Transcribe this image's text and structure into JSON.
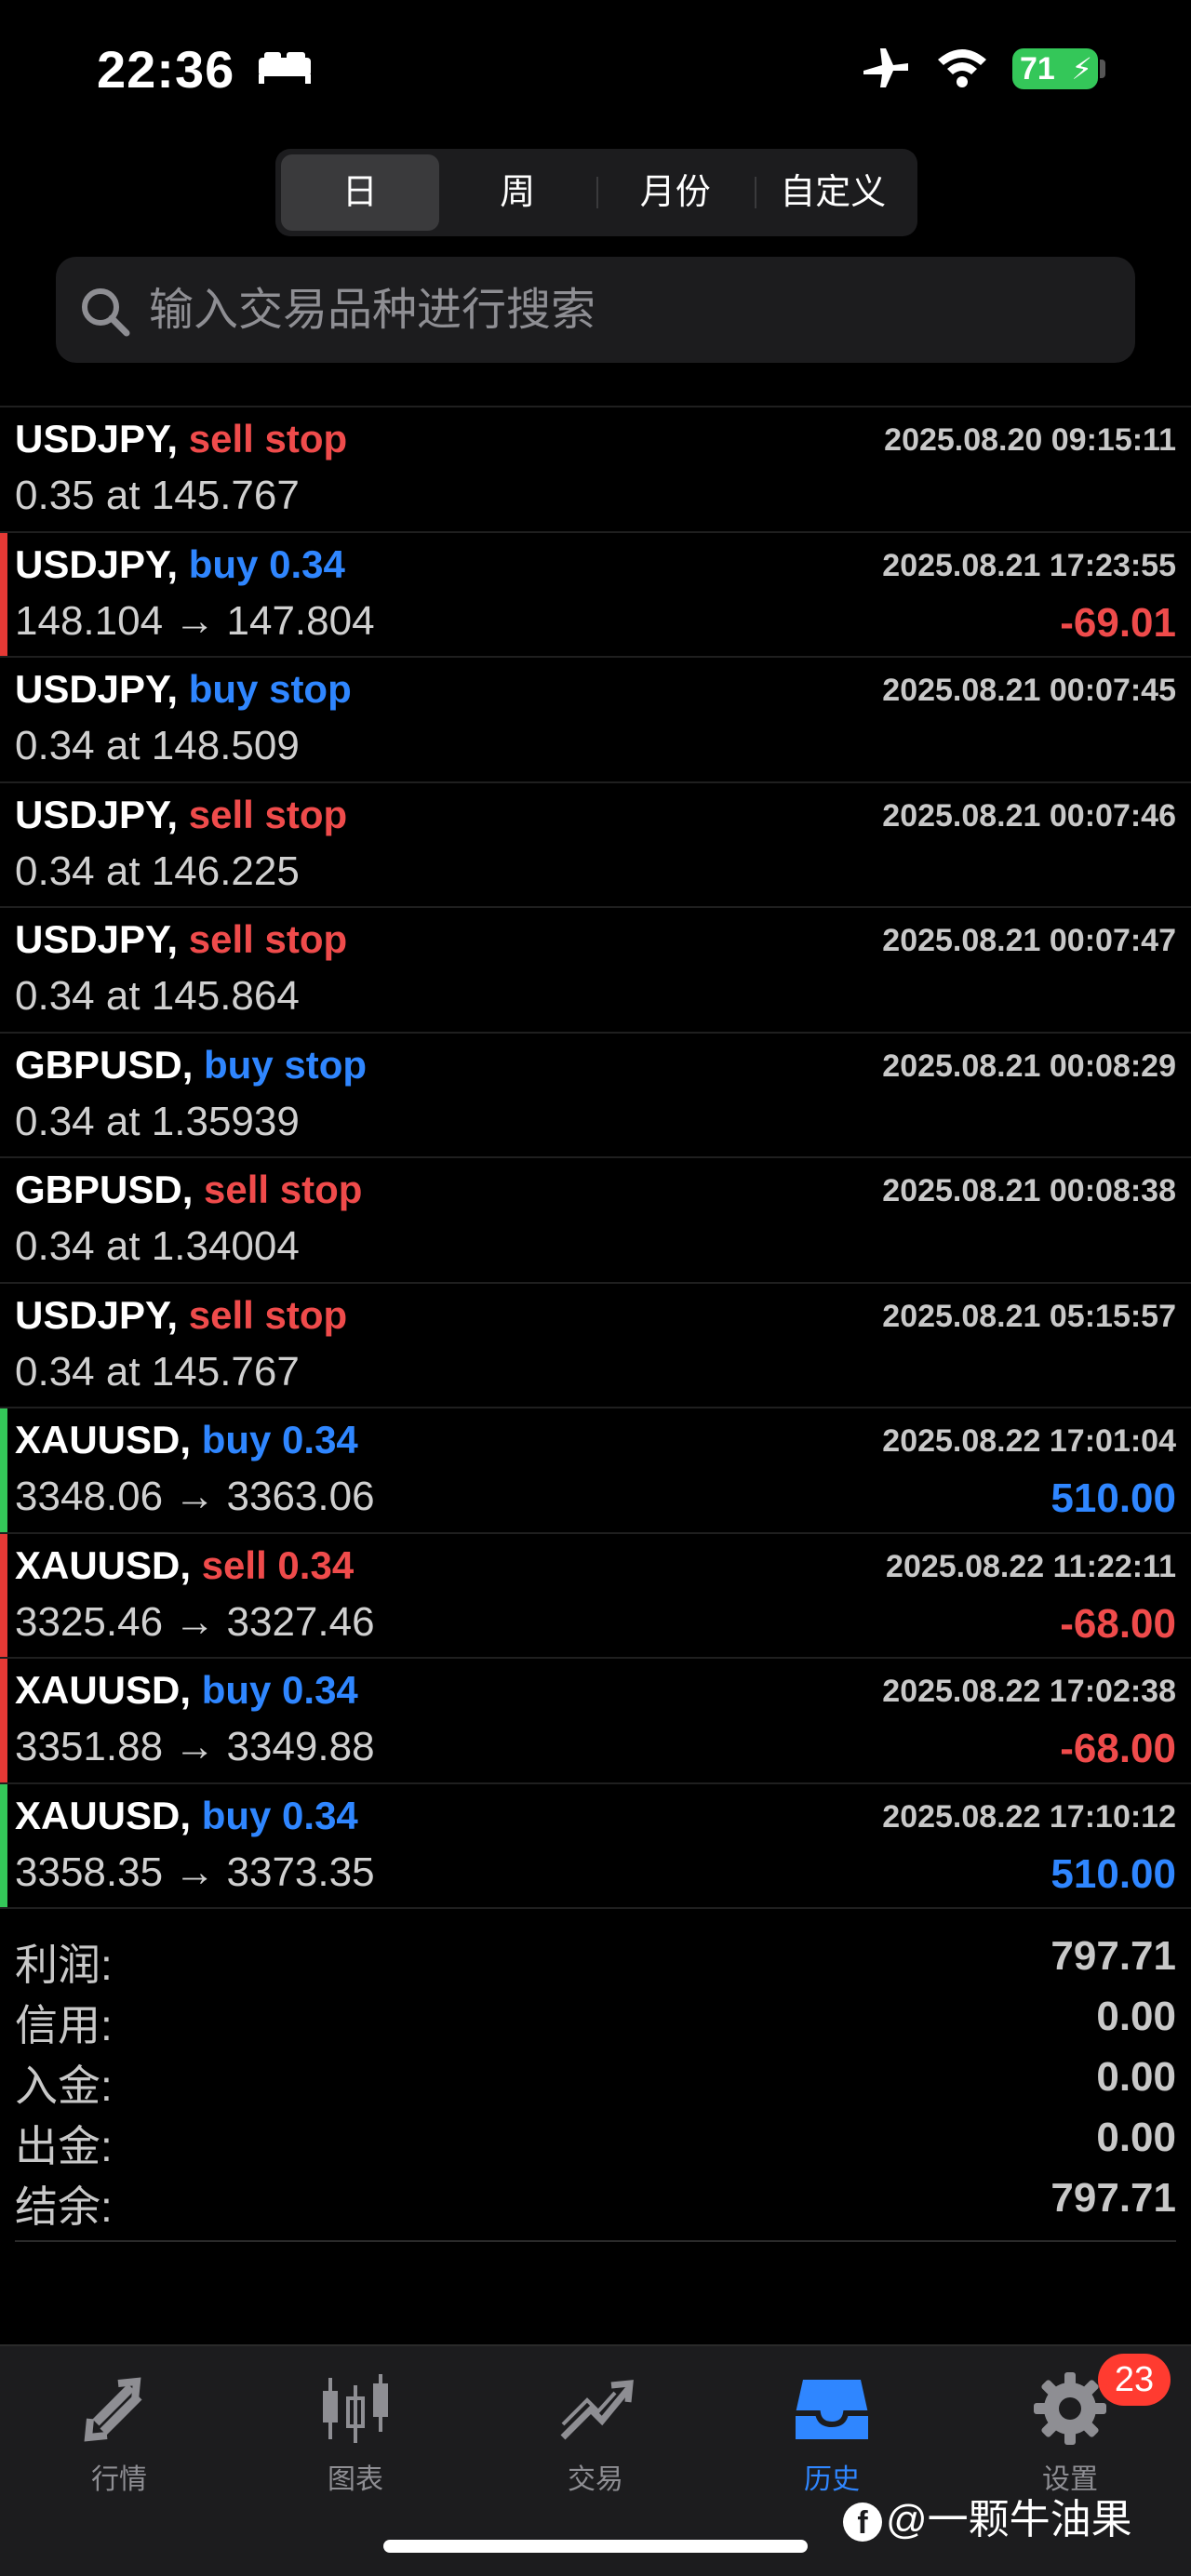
{
  "status_bar": {
    "time": "22:36",
    "battery": "71"
  },
  "segments": [
    "日",
    "周",
    "月份",
    "自定义"
  ],
  "active_segment": 0,
  "search": {
    "placeholder": "输入交易品种进行搜索"
  },
  "trades": [
    {
      "symbol": "USDJPY,",
      "side": "sell stop",
      "side_color": "red",
      "detail": "0.35 at 145.767",
      "time": "2025.08.20 09:15:11",
      "profit": "",
      "bar": ""
    },
    {
      "symbol": "USDJPY,",
      "side": "buy 0.34",
      "side_color": "blue",
      "detail": "148.104 → 147.804",
      "time": "2025.08.21 17:23:55",
      "profit": "-69.01",
      "profit_color": "red",
      "bar": "red"
    },
    {
      "symbol": "USDJPY,",
      "side": "buy stop",
      "side_color": "blue",
      "detail": "0.34 at 148.509",
      "time": "2025.08.21 00:07:45",
      "profit": "",
      "bar": ""
    },
    {
      "symbol": "USDJPY,",
      "side": "sell stop",
      "side_color": "red",
      "detail": "0.34 at 146.225",
      "time": "2025.08.21 00:07:46",
      "profit": "",
      "bar": ""
    },
    {
      "symbol": "USDJPY,",
      "side": "sell stop",
      "side_color": "red",
      "detail": "0.34 at 145.864",
      "time": "2025.08.21 00:07:47",
      "profit": "",
      "bar": ""
    },
    {
      "symbol": "GBPUSD,",
      "side": "buy stop",
      "side_color": "blue",
      "detail": "0.34 at 1.35939",
      "time": "2025.08.21 00:08:29",
      "profit": "",
      "bar": ""
    },
    {
      "symbol": "GBPUSD,",
      "side": "sell stop",
      "side_color": "red",
      "detail": "0.34 at 1.34004",
      "time": "2025.08.21 00:08:38",
      "profit": "",
      "bar": ""
    },
    {
      "symbol": "USDJPY,",
      "side": "sell stop",
      "side_color": "red",
      "detail": "0.34 at 145.767",
      "time": "2025.08.21 05:15:57",
      "profit": "",
      "bar": ""
    },
    {
      "symbol": "XAUUSD,",
      "side": "buy 0.34",
      "side_color": "blue",
      "detail": "3348.06 → 3363.06",
      "time": "2025.08.22 17:01:04",
      "profit": "510.00",
      "profit_color": "blue",
      "bar": "green"
    },
    {
      "symbol": "XAUUSD,",
      "side": "sell 0.34",
      "side_color": "red",
      "detail": "3325.46 → 3327.46",
      "time": "2025.08.22 11:22:11",
      "profit": "-68.00",
      "profit_color": "red",
      "bar": "red"
    },
    {
      "symbol": "XAUUSD,",
      "side": "buy 0.34",
      "side_color": "blue",
      "detail": "3351.88 → 3349.88",
      "time": "2025.08.22 17:02:38",
      "profit": "-68.00",
      "profit_color": "red",
      "bar": "red"
    },
    {
      "symbol": "XAUUSD,",
      "side": "buy 0.34",
      "side_color": "blue",
      "detail": "3358.35 → 3373.35",
      "time": "2025.08.22 17:10:12",
      "profit": "510.00",
      "profit_color": "blue",
      "bar": "green"
    }
  ],
  "summary": [
    {
      "label": "利润:",
      "value": "797.71"
    },
    {
      "label": "信用:",
      "value": "0.00"
    },
    {
      "label": "入金:",
      "value": "0.00"
    },
    {
      "label": "出金:",
      "value": "0.00"
    },
    {
      "label": "结余:",
      "value": "797.71"
    }
  ],
  "tabs": [
    {
      "label": "行情",
      "icon": "quotes-arrows-icon"
    },
    {
      "label": "图表",
      "icon": "candlestick-chart-icon"
    },
    {
      "label": "交易",
      "icon": "trade-trend-icon"
    },
    {
      "label": "历史",
      "icon": "history-inbox-icon"
    },
    {
      "label": "设置",
      "icon": "gear-icon"
    }
  ],
  "active_tab": 3,
  "settings_badge": "23",
  "watermark": "@一颗牛油果",
  "colors": {
    "red": "#ef4b4b",
    "blue": "#2f86ff",
    "green": "#34c759",
    "background": "#000000"
  }
}
